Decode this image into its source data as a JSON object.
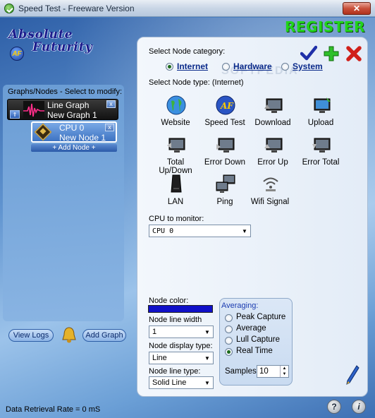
{
  "window": {
    "title": "Speed Test - Freeware Version",
    "close_glyph": "✕"
  },
  "branding": {
    "logo_line1": "Absolute",
    "logo_line2": "Futurity",
    "badge": "AF",
    "register_label": "REGISTER",
    "register_color": "#22d41b"
  },
  "left_panel": {
    "header": "Graphs/Nodes - Select to modify:",
    "graph": {
      "type_label": "Line Graph",
      "name": "New Graph 1",
      "close_glyph": "x",
      "collapse_glyph": "⇑"
    },
    "node": {
      "name": "CPU 0",
      "sub": "New Node 1",
      "close_glyph": "x"
    },
    "add_node_label": "+ Add Node +",
    "view_logs_label": "View Logs",
    "add_graph_label": "Add Graph"
  },
  "node_category": {
    "label": "Select Node category:",
    "options": [
      {
        "label": "Internet",
        "selected": true
      },
      {
        "label": "Hardware",
        "selected": false
      },
      {
        "label": "System",
        "selected": false
      }
    ]
  },
  "node_type": {
    "label": "Select Node type:  (Internet)",
    "tiles": [
      {
        "label": "Website",
        "icon": "globe-icon"
      },
      {
        "label": "Speed Test",
        "icon": "af-logo-icon"
      },
      {
        "label": "Download",
        "icon": "monitor-download-icon"
      },
      {
        "label": "Upload",
        "icon": "monitor-upload-icon"
      },
      {
        "label": "Total Up/Down",
        "icon": "monitor-updown-icon"
      },
      {
        "label": "Error Down",
        "icon": "monitor-error-down-icon"
      },
      {
        "label": "Error Up",
        "icon": "monitor-error-up-icon"
      },
      {
        "label": "Error Total",
        "icon": "monitor-error-total-icon"
      },
      {
        "label": "LAN",
        "icon": "router-icon"
      },
      {
        "label": "Ping",
        "icon": "network-computers-icon"
      },
      {
        "label": "Wifi Signal",
        "icon": "wifi-icon"
      }
    ]
  },
  "cpu_monitor": {
    "label": "CPU to monitor:",
    "value": "CPU  0"
  },
  "node_settings": {
    "color_label": "Node color:",
    "color_value": "#1010c8",
    "line_width_label": "Node line width",
    "line_width_value": "1",
    "display_type_label": "Node display type:",
    "display_type_value": "Line",
    "line_type_label": "Node line type:",
    "line_type_value": "Solid Line"
  },
  "averaging": {
    "title": "Averaging:",
    "options": [
      {
        "label": "Peak Capture",
        "selected": false
      },
      {
        "label": "Average",
        "selected": false
      },
      {
        "label": "Lull Capture",
        "selected": false
      },
      {
        "label": "Real Time",
        "selected": true
      }
    ],
    "samples_label": "Samples:",
    "samples_value": "10"
  },
  "status_bar": {
    "text": "Data Retrieval Rate = 0 mS"
  },
  "help": {
    "help_glyph": "?",
    "info_glyph": "i"
  },
  "watermark": "SOFTPEDIA"
}
